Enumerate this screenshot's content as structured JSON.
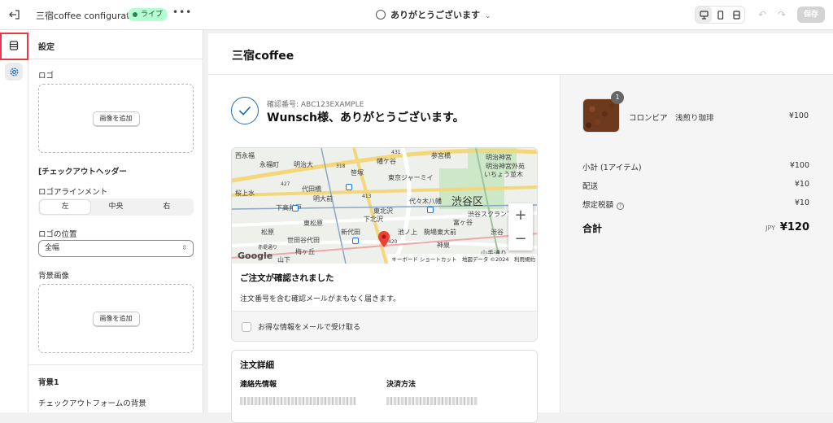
{
  "topbar": {
    "store_title": "三宿coffee configuration",
    "live_badge": "ライブ",
    "more": "•••",
    "page_selector": "ありがとうございます",
    "save_label": "保存"
  },
  "panel": {
    "header": "設定",
    "logo_label": "ロゴ",
    "add_image": "画像を追加",
    "checkout_header": "[チェックアウトヘッダー",
    "logo_alignment": "ロゴアラインメント",
    "alignment_options": [
      "左",
      "中央",
      "右"
    ],
    "alignment_selected": "左",
    "logo_position": "ロゴの位置",
    "logo_position_value": "全幅",
    "background_image": "背景画像",
    "add_image_2": "画像を追加",
    "background1": "背景1",
    "checkout_form_bg": "チェックアウトフォームの背景"
  },
  "preview": {
    "shop_name": "三宿coffee",
    "confirmation_number": "確認番号: ABC123EXAMPLE",
    "thanks_heading": "Wunsch様、ありがとうございます。",
    "map": {
      "labels": [
        "西永福",
        "永福町",
        "明治大",
        "幡ケ谷",
        "参宮橋",
        "明治神宮",
        "笹塚",
        "東京ジャーミイ",
        "明治神宮外苑",
        "いちょう並木",
        "代田橋",
        "代々木八幡",
        "渋谷区",
        "桜上水",
        "下高井戸",
        "明大前",
        "東北沢",
        "富ヶ谷",
        "下北沢",
        "東松原",
        "渋谷スクランブル",
        "松原",
        "新代田",
        "池ノ上",
        "駒場東大前",
        "渋谷",
        "世田谷代田",
        "赤堤通り",
        "梅ヶ丘",
        "神泉",
        "山下",
        "山手通り"
      ],
      "road_numbers": [
        "431",
        "318",
        "427",
        "413",
        "420"
      ],
      "attribution": "キーボード ショートカット　地図データ ©2024　利用規約",
      "google": "Google",
      "zoom_in": "+",
      "zoom_out": "−"
    },
    "order_confirmed_title": "ご注文が確認されました",
    "order_confirmed_text": "注文番号を含む確認メールがまもなく届きます。",
    "newsletter_label": "お得な情報をメールで受け取る",
    "order_details_title": "注文詳細",
    "contact_label": "連絡先情報",
    "payment_label": "決済方法"
  },
  "summary": {
    "quantity": "1",
    "product_name": "コロンビア　浅煎り珈琲",
    "product_price": "¥100",
    "subtotal_label": "小計 (1アイテム)",
    "subtotal_value": "¥100",
    "shipping_label": "配送",
    "shipping_value": "¥10",
    "tax_label": "想定税額",
    "tax_value": "¥10",
    "info_icon": "?",
    "total_label": "合計",
    "currency": "JPY",
    "total_value": "¥120"
  },
  "colors": {
    "accent": "#1f6fb5",
    "live_badge_bg": "#b4fed2",
    "highlight": "#e8364b"
  }
}
